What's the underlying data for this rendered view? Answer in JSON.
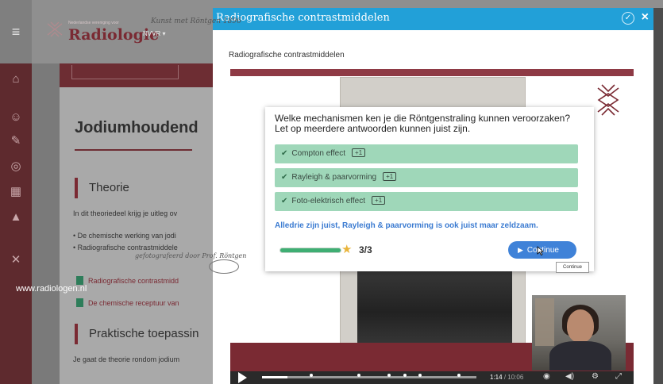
{
  "background_page": {
    "logo_small": "Nederlandse vereniging voor",
    "logo_text": "Radiologie",
    "org_menu": "NVVR",
    "heading": "Jodiumhoudend",
    "section1_title": "Theorie",
    "section1_intro": "In dit theoriedeel krijg je uitleg ov",
    "bullets": [
      "De chemische werking van jodi",
      "Radiografische contrastmiddele"
    ],
    "links": [
      "Radiografische contrastmidd",
      "De chemische receptuur van"
    ],
    "section2_title": "Praktische toepassin",
    "section2_intro": "Je gaat de theorie rondom jodium"
  },
  "modal": {
    "title": "Radiografische contrastmiddelen",
    "subtitle": "Radiografische contrastmiddelen"
  },
  "slide": {
    "handwriting": "Kunst met Röntgen 1896",
    "photo_caption": "gefotografeerd door Prof. Röntgen",
    "footer_url": "www.radiologen.nl"
  },
  "quiz": {
    "question": "Welke mechanismen ken je die Röntgenstraling kunnen veroorzaken? Let op meerdere antwoorden kunnen juist zijn.",
    "answers": [
      {
        "label": "Compton effect",
        "points": "+1"
      },
      {
        "label": "Rayleigh & paarvorming",
        "points": "+1"
      },
      {
        "label": "Foto-elektrisch effect",
        "points": "+1"
      }
    ],
    "feedback": "Alledrie zijn juist, Rayleigh & paarvorming is ook juist maar zeldzaam.",
    "score": "3/3",
    "progress_fraction": 1.0,
    "continue_label": "Continue",
    "tooltip": "Continue"
  },
  "player": {
    "current_time": "1:14",
    "total_time": "/ 10:06",
    "progress_fraction": 0.12
  },
  "colors": {
    "brand": "#7a2a33",
    "titlebar": "#22a0d8",
    "answer_bg": "#9fd7b9",
    "accent_blue": "#3f82d8"
  }
}
